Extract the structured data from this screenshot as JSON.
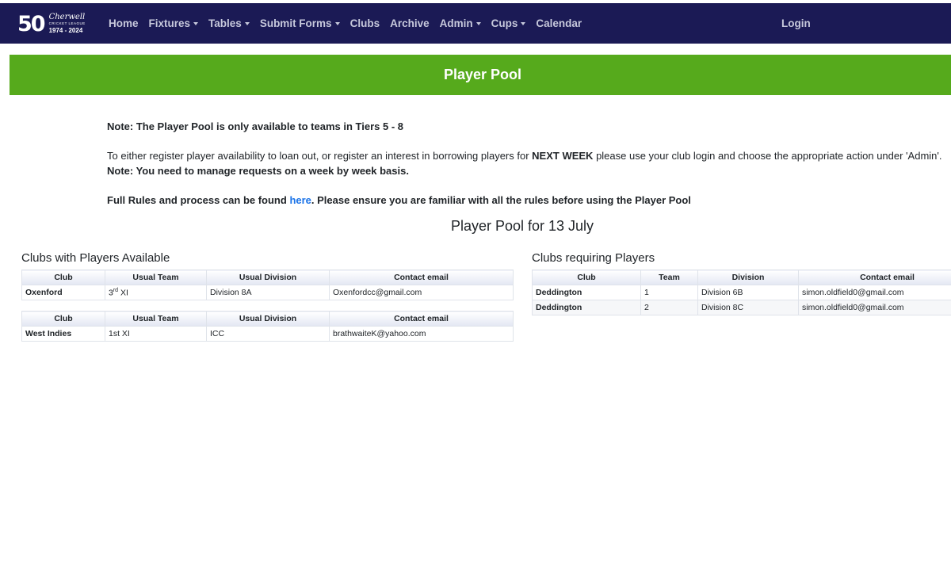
{
  "brand": {
    "mark": "50",
    "name": "Cherwell",
    "sub": "CRICKET LEAGUE",
    "years": "1974 - 2024"
  },
  "nav": {
    "items": [
      {
        "label": "Home",
        "dropdown": false
      },
      {
        "label": "Fixtures",
        "dropdown": true
      },
      {
        "label": "Tables",
        "dropdown": true
      },
      {
        "label": "Submit Forms",
        "dropdown": true
      },
      {
        "label": "Clubs",
        "dropdown": false
      },
      {
        "label": "Archive",
        "dropdown": false
      },
      {
        "label": "Admin",
        "dropdown": true
      },
      {
        "label": "Cups",
        "dropdown": true
      },
      {
        "label": "Calendar",
        "dropdown": false
      }
    ],
    "login": "Login"
  },
  "banner": {
    "title": "Player Pool"
  },
  "notes": {
    "line1": "Note: The Player Pool is only available to teams in Tiers 5 - 8",
    "line2_pre": "To either register player availability to loan out, or register an interest in borrowing players for ",
    "line2_bold": "NEXT WEEK",
    "line2_post": " please use your club login and choose the appropriate action under 'Admin'.",
    "line3": "Note: You need to manage requests on a week by week basis.",
    "line4_pre": "Full Rules and process can be found ",
    "line4_link": "here",
    "line4_post": ". Please ensure you are familiar with all the rules before using the Player Pool"
  },
  "pool_date": "Player Pool for 13 July",
  "available": {
    "title": "Clubs with Players Available",
    "headers": [
      "Club",
      "Usual Team",
      "Usual Division",
      "Contact email"
    ],
    "tables": [
      {
        "club": "Oxenford",
        "team_num": "3",
        "team_sup": "rd",
        "team_rest": " XI",
        "division": "Division 8A",
        "email": "Oxenfordcc@gmail.com"
      },
      {
        "club": "West Indies",
        "team_num": "1st XI",
        "team_sup": "",
        "team_rest": "",
        "division": "ICC",
        "email": "brathwaiteK@yahoo.com"
      }
    ]
  },
  "requiring": {
    "title": "Clubs requiring Players",
    "headers": [
      "Club",
      "Team",
      "Division",
      "Contact email"
    ],
    "rows": [
      {
        "club": "Deddington",
        "team": "1",
        "division": "Division 6B",
        "email": "simon.oldfield0@gmail.com"
      },
      {
        "club": "Deddington",
        "team": "2",
        "division": "Division 8C",
        "email": "simon.oldfield0@gmail.com"
      }
    ]
  }
}
